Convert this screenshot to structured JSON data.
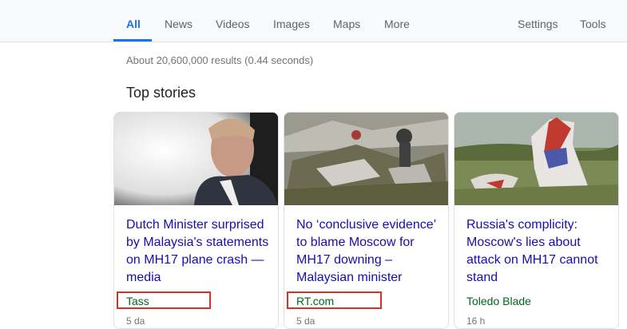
{
  "tabs": [
    {
      "label": "All",
      "active": true
    },
    {
      "label": "News"
    },
    {
      "label": "Videos"
    },
    {
      "label": "Images"
    },
    {
      "label": "Maps"
    },
    {
      "label": "More"
    }
  ],
  "tools": {
    "settings": "Settings",
    "tools": "Tools"
  },
  "result_stats": "About 20,600,000 results (0.44 seconds)",
  "top_stories": {
    "title": "Top stories",
    "cards": [
      {
        "title": "Dutch Minister surprised by Malaysia's statements on MH17 plane crash — media",
        "source": "Tass",
        "meta": "5 da"
      },
      {
        "title": "No ‘conclusive evidence’ to blame Moscow for MH17 downing – Malaysian minister",
        "source": "RT.com",
        "meta": "5 da"
      },
      {
        "title": "Russia's complicity: Moscow's lies about attack on MH17 cannot stand",
        "source": "Toledo Blade",
        "meta": "16 h"
      }
    ]
  },
  "colors": {
    "accent": "#1a73e8",
    "link": "#1a0dab",
    "source": "#006621",
    "highlight": "#d93025"
  }
}
